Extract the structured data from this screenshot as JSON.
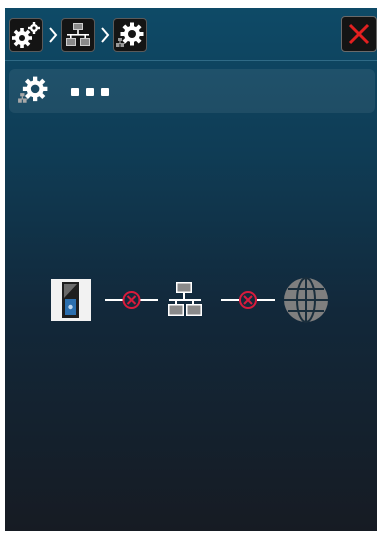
{
  "breadcrumb": {
    "items": [
      {
        "icon": "settings-gears-icon"
      },
      {
        "icon": "network-icon"
      },
      {
        "icon": "network-settings-icon"
      }
    ],
    "separator_icon": "chevron-right-icon"
  },
  "close_button": {
    "icon": "close-x-icon",
    "color": "#e32020"
  },
  "section": {
    "icon": "network-settings-icon",
    "status_dots": 3
  },
  "connection_diagram": {
    "device_icon": "device-icon",
    "switch_icon": "network-switch-icon",
    "internet_icon": "globe-icon",
    "link_status": [
      "disconnected",
      "disconnected"
    ],
    "error_color": "#d81b3c"
  }
}
